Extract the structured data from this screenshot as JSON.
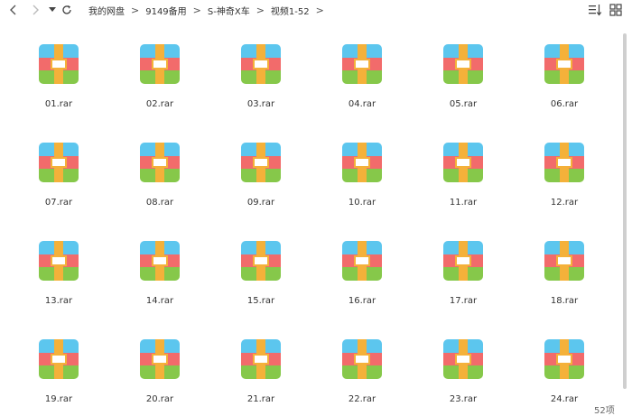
{
  "toolbar": {
    "back_icon": "chevron-left-icon",
    "forward_icon": "chevron-right-icon",
    "dropdown_icon": "caret-down-icon",
    "refresh_icon": "refresh-icon",
    "sort_icon": "sort-icon",
    "view_icon": "grid-view-icon"
  },
  "breadcrumb": [
    "我的网盘",
    "9149备用",
    "S-神奇X车",
    "视频1-52"
  ],
  "files": [
    {
      "name": "01.rar"
    },
    {
      "name": "02.rar"
    },
    {
      "name": "03.rar"
    },
    {
      "name": "04.rar"
    },
    {
      "name": "05.rar"
    },
    {
      "name": "06.rar"
    },
    {
      "name": "07.rar"
    },
    {
      "name": "08.rar"
    },
    {
      "name": "09.rar"
    },
    {
      "name": "10.rar"
    },
    {
      "name": "11.rar"
    },
    {
      "name": "12.rar"
    },
    {
      "name": "13.rar"
    },
    {
      "name": "14.rar"
    },
    {
      "name": "15.rar"
    },
    {
      "name": "16.rar"
    },
    {
      "name": "17.rar"
    },
    {
      "name": "18.rar"
    },
    {
      "name": "19.rar"
    },
    {
      "name": "20.rar"
    },
    {
      "name": "21.rar"
    },
    {
      "name": "22.rar"
    },
    {
      "name": "23.rar"
    },
    {
      "name": "24.rar"
    }
  ],
  "status": {
    "count": "52项"
  },
  "colors": {
    "archive_blue": "#5cc6ee",
    "archive_red": "#f26b6b",
    "archive_green": "#86c84a",
    "archive_strap": "#f4b13a"
  }
}
